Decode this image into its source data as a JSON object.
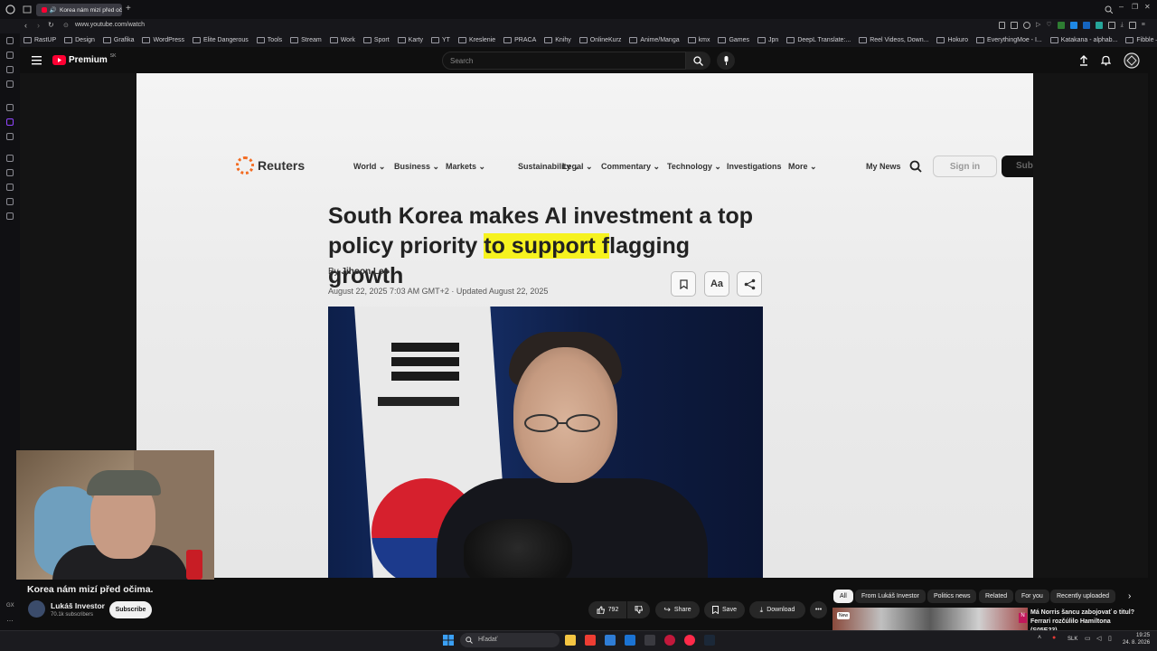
{
  "browser": {
    "tab_title": "Korea nám mizí před oč",
    "url": "www.youtube.com/watch",
    "bookmarks": [
      "RastUP",
      "Design",
      "Grafika",
      "WordPress",
      "Elite Dangerous",
      "Tools",
      "Stream",
      "Work",
      "Sport",
      "Karty",
      "YT",
      "Kreslenie",
      "PRACA",
      "Knihy",
      "OnlineKurz",
      "Anime/Manga",
      "kmx",
      "Games",
      "Jpn",
      "DeepL Translate:...",
      "Reel Videos, Down...",
      "Hokuro",
      "EverythingMoe - I...",
      "Katakana - alphab...",
      "Fibble — Lie Your..."
    ]
  },
  "youtube": {
    "logo_text": "Premium",
    "region": "SK",
    "search_placeholder": "Search"
  },
  "article": {
    "publisher": "Reuters",
    "nav": [
      "World",
      "Business",
      "Markets",
      "Sustainability",
      "Legal",
      "Commentary",
      "Technology",
      "Investigations",
      "More"
    ],
    "nav_dropdown": [
      true,
      true,
      true,
      true,
      true,
      true,
      true,
      false,
      true
    ],
    "my_news": "My News",
    "sign_in": "Sign in",
    "subscribe_partial": "Sub",
    "headline_before": "South Korea makes AI investment a top policy priority ",
    "headline_highlight": "to support f",
    "headline_after": "lagging growth",
    "byline_prefix": "By ",
    "author": "Jihoon Lee",
    "dateline": "August 22, 2025 7:03 AM GMT+2 · Updated August 22, 2025",
    "text_size_label": "Aa"
  },
  "video": {
    "title": "Korea nám mizí před očima.",
    "channel": "Lukáš Investor",
    "subscribers": "70.1k subscribers",
    "subscribe_label": "Subscribe",
    "likes": "792",
    "share_label": "Share",
    "save_label": "Save",
    "download_label": "Download"
  },
  "chips": [
    "All",
    "From Lukáš Investor",
    "Politics news",
    "Related",
    "For you",
    "Recently uploaded"
  ],
  "recommendation": {
    "badge": "New",
    "title": "Má Norris šancu zabojovať o titul? Ferrari rozčúlilo Hamiltona (S05E23)"
  },
  "taskbar": {
    "search_placeholder": "Hľadať",
    "language": "SLK",
    "time": "19:25",
    "date": "24. 8. 2026"
  },
  "sidebar": {
    "bottom_label": "GX"
  }
}
